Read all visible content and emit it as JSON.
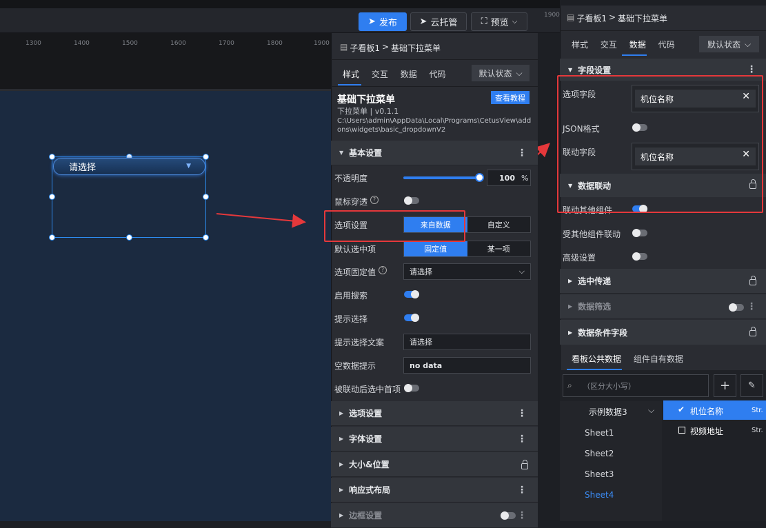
{
  "toolbar": {
    "publish": "发布",
    "cloud": "云托管",
    "preview": "预览"
  },
  "ruler": {
    "ticks": [
      "1300",
      "1400",
      "1500",
      "1600",
      "1700",
      "1800",
      "1900"
    ],
    "right_tick": "1900"
  },
  "widget": {
    "placeholder": "请选择"
  },
  "mid": {
    "breadcrumb_parent": "子看板1",
    "breadcrumb_sep": ">",
    "breadcrumb_current": "基础下拉菜单",
    "tabs": [
      "样式",
      "交互",
      "数据",
      "代码"
    ],
    "state": "默认状态",
    "title": "基础下拉菜单",
    "tutorial": "查看教程",
    "subtitle": "下拉菜单 | v0.1.1",
    "path": "C:\\Users\\admin\\AppData\\Local\\Programs\\CetusView\\addons\\widgets\\basic_dropdownV2",
    "basic_section": "基本设置",
    "opacity_label": "不透明度",
    "opacity_value": "100",
    "opacity_level": 1.0,
    "percent": "%",
    "mouse_through": "鼠标穿透",
    "option_settings": "选项设置",
    "from_data": "来自数据",
    "custom": "自定义",
    "default_selected": "默认选中项",
    "fixed_value": "固定值",
    "some_item": "某一项",
    "option_fixed_value": "选项固定值",
    "select_placeholder": "请选择",
    "enable_search": "启用搜索",
    "hint_select": "提示选择",
    "hint_text_label": "提示选择文案",
    "hint_text_value": "请选择",
    "empty_hint_label": "空数据提示",
    "empty_hint_value": "no data",
    "after_link_first": "被联动后选中首项",
    "sections": [
      "选项设置",
      "字体设置",
      "大小&位置",
      "响应式布局",
      "边框设置"
    ]
  },
  "right": {
    "breadcrumb_parent": "子看板1",
    "breadcrumb_sep": ">",
    "breadcrumb_current": "基础下拉菜单",
    "tabs": [
      "样式",
      "交互",
      "数据",
      "代码"
    ],
    "state": "默认状态",
    "field_settings": "字段设置",
    "option_field": "选项字段",
    "option_field_value": "机位名称",
    "json_format": "JSON格式",
    "link_field": "联动字段",
    "link_field_value": "机位名称",
    "data_link": "数据联动",
    "link_other": "联动其他组件",
    "linked_by_other": "受其他组件联动",
    "advanced": "高级设置",
    "selected_pass": "选中传递",
    "data_filter": "数据筛选",
    "data_condition": "数据条件字段",
    "sub_tabs": [
      "看板公共数据",
      "组件自有数据"
    ],
    "search_placeholder": "（区分大小写）",
    "dataset": "示例数据3",
    "sheets": [
      "Sheet1",
      "Sheet2",
      "Sheet3",
      "Sheet4"
    ],
    "fields": [
      {
        "name": "机位名称",
        "type": "Str.",
        "checked": true
      },
      {
        "name": "视频地址",
        "type": "Str.",
        "checked": false
      }
    ]
  },
  "colors": {
    "accent": "#2f7ef0",
    "highlight": "#e5383b"
  }
}
